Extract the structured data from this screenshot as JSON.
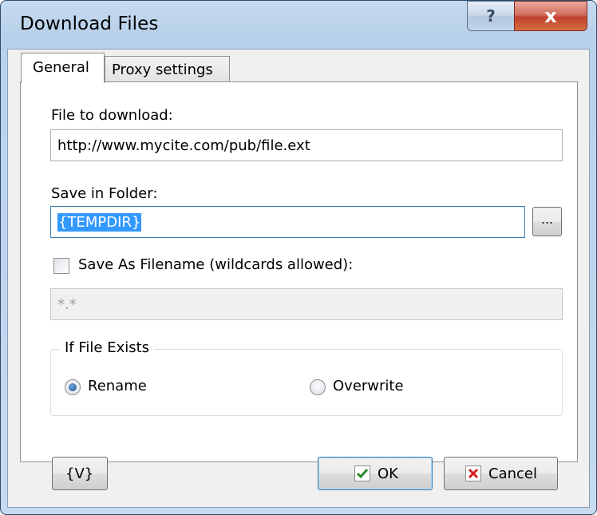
{
  "window": {
    "title": "Download Files",
    "help_glyph": "?",
    "close_glyph": "x"
  },
  "tabs": [
    {
      "label": "General",
      "active": true
    },
    {
      "label": "Proxy settings",
      "active": false
    }
  ],
  "fields": {
    "file_to_download": {
      "label": "File to download:",
      "value": "http://www.mycite.com/pub/file.ext"
    },
    "save_in_folder": {
      "label": "Save in Folder:",
      "value": "{TEMPDIR}",
      "browse_label": "..."
    },
    "save_as_filename": {
      "label": "Save As Filename (wildcards allowed):",
      "checked": false,
      "value": "*.*"
    }
  },
  "if_file_exists": {
    "title": "If File Exists",
    "options": [
      {
        "label": "Rename",
        "selected": true
      },
      {
        "label": "Overwrite",
        "selected": false
      }
    ]
  },
  "buttons": {
    "variables": "{V}",
    "ok": "OK",
    "cancel": "Cancel"
  },
  "colors": {
    "selection": "#3399ff",
    "ok_check": "#2a8a2a",
    "cancel_x": "#d42020"
  }
}
